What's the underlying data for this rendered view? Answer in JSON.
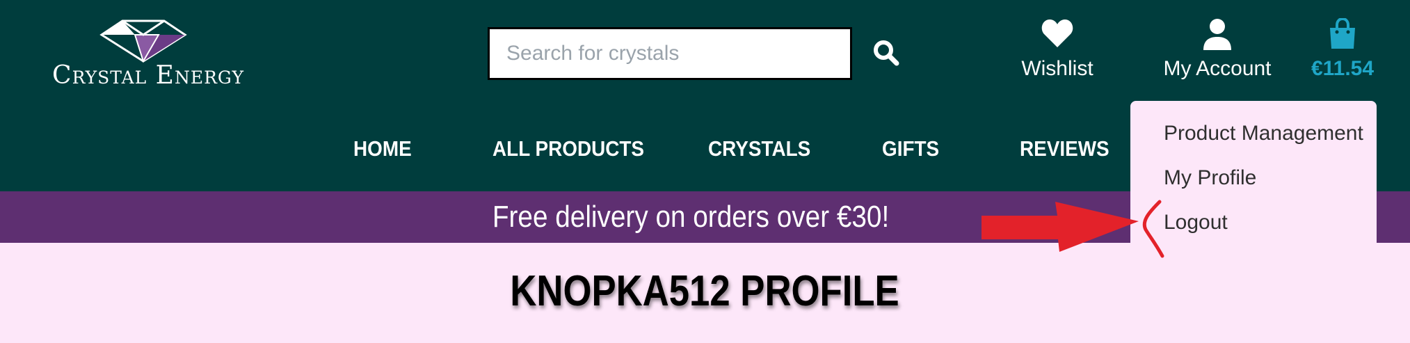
{
  "brand": {
    "name": "Crystal Energy"
  },
  "search": {
    "placeholder": "Search for crystals",
    "value": ""
  },
  "header": {
    "wishlist_label": "Wishlist",
    "account_label": "My Account",
    "cart_total": "€11.54"
  },
  "nav": {
    "items": [
      {
        "label": "HOME"
      },
      {
        "label": "ALL PRODUCTS"
      },
      {
        "label": "CRYSTALS"
      },
      {
        "label": "GIFTS"
      },
      {
        "label": "REVIEWS"
      }
    ]
  },
  "account_menu": {
    "items": [
      {
        "label": "Product Management"
      },
      {
        "label": "My Profile"
      },
      {
        "label": "Logout"
      }
    ]
  },
  "banner": {
    "text": "Free delivery on orders over €30!"
  },
  "page": {
    "title": "KNOPKA512 PROFILE"
  },
  "colors": {
    "header_bg": "#003d3d",
    "banner_bg": "#5e2f71",
    "page_bg": "#fde7f9",
    "accent": "#1fa6c7",
    "annotation_red": "#e3222a"
  },
  "icons": [
    "crystal-logo-icon",
    "search-icon",
    "heart-icon",
    "user-icon",
    "shopping-bag-icon",
    "red-arrow-annotation-icon"
  ]
}
